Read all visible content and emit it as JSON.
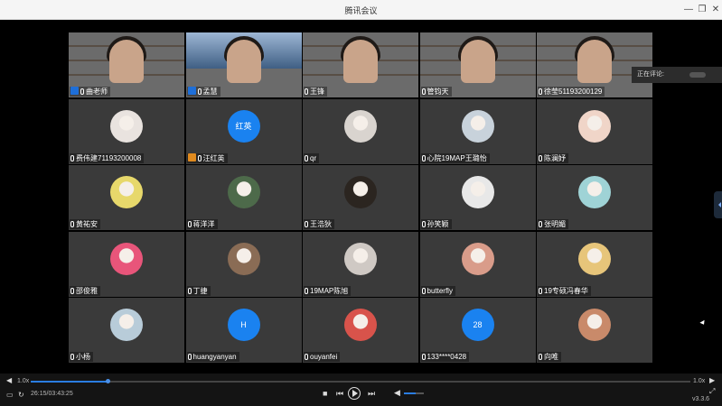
{
  "window": {
    "title": "腾讯会议"
  },
  "side_panel": {
    "comment_label": "正在评论:"
  },
  "participants": [
    {
      "name": "曲老师",
      "kind": "video",
      "host": "blue"
    },
    {
      "name": "孟慧",
      "kind": "video-sky",
      "host": "blue"
    },
    {
      "name": "王锋",
      "kind": "video"
    },
    {
      "name": "管钧天",
      "kind": "video"
    },
    {
      "name": "徐莹51193200129",
      "kind": "video"
    },
    {
      "name": "费伟建71193200008",
      "kind": "avatar",
      "color": "#e9e3df"
    },
    {
      "name": "汪红英",
      "kind": "text",
      "avatar_text": "红英",
      "host": "orange"
    },
    {
      "name": "qr",
      "kind": "avatar",
      "color": "#d9d4cf"
    },
    {
      "name": "心院19MAP王璐怡",
      "kind": "avatar",
      "color": "#c8d2db"
    },
    {
      "name": "陈澜妤",
      "kind": "avatar",
      "color": "#f0d5c8"
    },
    {
      "name": "黄祐安",
      "kind": "avatar",
      "color": "#e7d86b"
    },
    {
      "name": "蒋洋洋",
      "kind": "avatar",
      "color": "#4d6a4a"
    },
    {
      "name": "王浩狄",
      "kind": "avatar",
      "color": "#2b2520"
    },
    {
      "name": "孙笑颖",
      "kind": "avatar",
      "color": "#e8e8e8"
    },
    {
      "name": "张明媚",
      "kind": "avatar",
      "color": "#9fd3d6"
    },
    {
      "name": "邵俊雅",
      "kind": "avatar",
      "color": "#e8557a"
    },
    {
      "name": "丁捷",
      "kind": "avatar",
      "color": "#8a6c55"
    },
    {
      "name": "19MAP陈旭",
      "kind": "avatar",
      "color": "#cfc9c4"
    },
    {
      "name": "butterfly",
      "kind": "avatar",
      "color": "#d99c8a"
    },
    {
      "name": "19专硕冯春华",
      "kind": "avatar",
      "color": "#e7c57a"
    },
    {
      "name": "小杨",
      "kind": "avatar",
      "color": "#b8ccd9"
    },
    {
      "name": "huangyanyan",
      "kind": "text",
      "avatar_text": "H"
    },
    {
      "name": "ouyanfei",
      "kind": "avatar",
      "color": "#d8534b"
    },
    {
      "name": "133****0428",
      "kind": "text",
      "avatar_text": "28"
    },
    {
      "name": "向唯",
      "kind": "avatar",
      "color": "#c98a6a"
    }
  ],
  "player": {
    "speed_left": "1.0x",
    "speed_right": "1.0x",
    "time": "26:15/03:43:25",
    "progress": 0.117,
    "volume": 0.6,
    "version": "v3.3.6"
  },
  "colors": {
    "accent": "#1a82f0",
    "tile": "#3a3a3a",
    "background": "#000000"
  }
}
